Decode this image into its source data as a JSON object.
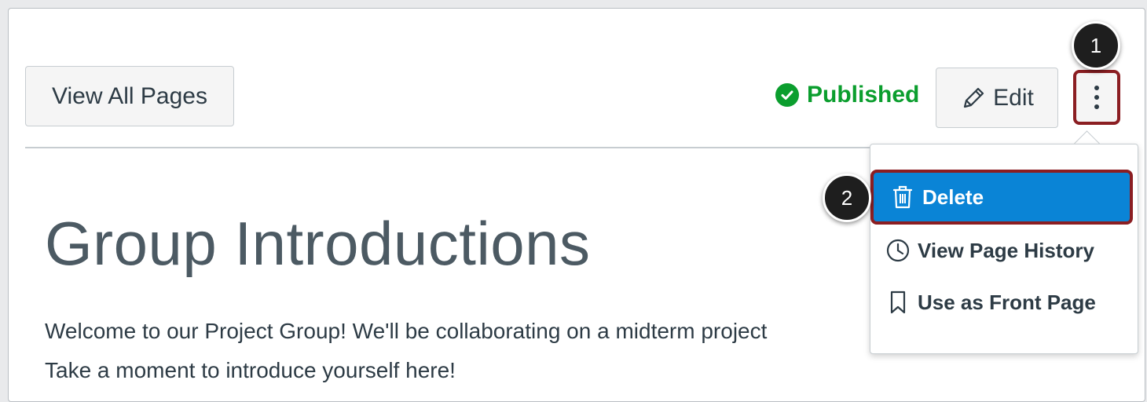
{
  "header": {
    "view_all_label": "View All Pages",
    "status_label": "Published",
    "edit_label": "Edit"
  },
  "page": {
    "title": "Group Introductions",
    "body_line1": "Welcome to our Project Group! We'll be collaborating on a midterm project",
    "body_line2": "Take a moment to introduce yourself here!"
  },
  "menu": {
    "items": [
      {
        "label": "Delete",
        "icon": "trash-icon"
      },
      {
        "label": "View Page History",
        "icon": "clock-icon"
      },
      {
        "label": "Use as Front Page",
        "icon": "bookmark-icon"
      }
    ]
  },
  "callouts": {
    "step1": "1",
    "step2": "2"
  },
  "colors": {
    "published": "#0b9e2e",
    "menu_highlight": "#0a84d6",
    "callout_border": "#8b1e22"
  }
}
